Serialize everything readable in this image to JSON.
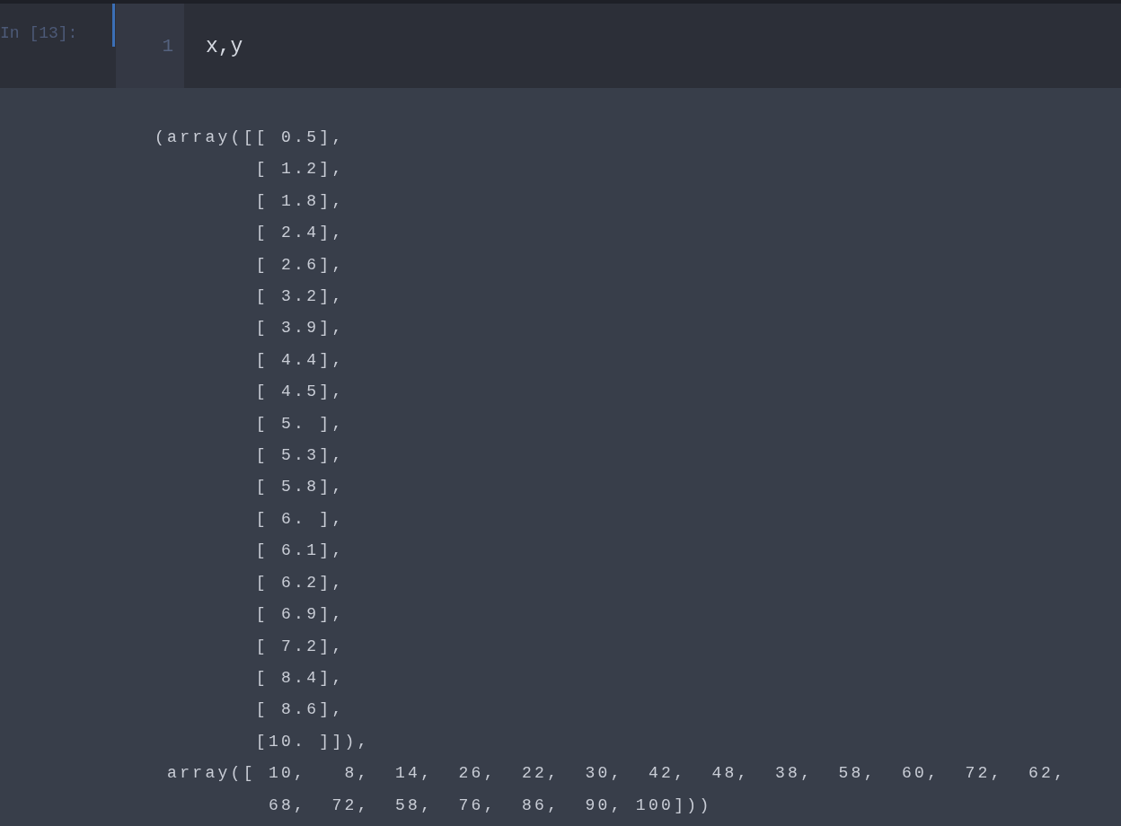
{
  "cell": {
    "prompt": "In [13]:",
    "active": true,
    "line_numbers": [
      "1"
    ],
    "code_lines": [
      "x,y"
    ]
  },
  "output": {
    "lines": [
      "(array([[ 0.5],",
      "        [ 1.2],",
      "        [ 1.8],",
      "        [ 2.4],",
      "        [ 2.6],",
      "        [ 3.2],",
      "        [ 3.9],",
      "        [ 4.4],",
      "        [ 4.5],",
      "        [ 5. ],",
      "        [ 5.3],",
      "        [ 5.8],",
      "        [ 6. ],",
      "        [ 6.1],",
      "        [ 6.2],",
      "        [ 6.9],",
      "        [ 7.2],",
      "        [ 8.4],",
      "        [ 8.6],",
      "        [10. ]]),",
      " array([ 10,   8,  14,  26,  22,  30,  42,  48,  38,  58,  60,  72,  62,",
      "         68,  72,  58,  76,  86,  90, 100]))"
    ]
  }
}
